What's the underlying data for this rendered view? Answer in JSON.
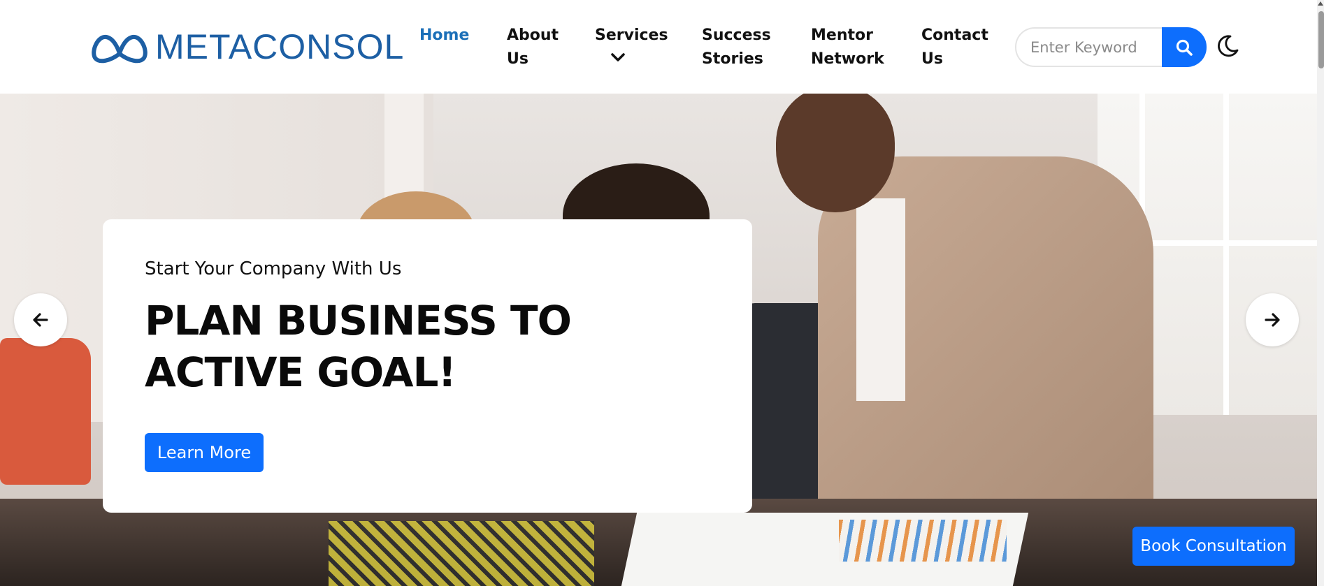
{
  "brand": {
    "name": "METACONSOL",
    "logo_icon": "infinity-mountain-logo",
    "color": "#1d5fa4"
  },
  "nav": {
    "home": "Home",
    "about_line1": "About",
    "about_line2": "Us",
    "services": "Services",
    "success_line1": "Success",
    "success_line2": "Stories",
    "mentor_line1": "Mentor",
    "mentor_line2": "Network",
    "contact_line1": "Contact",
    "contact_line2": "Us",
    "active_color": "#1b6fb8"
  },
  "search": {
    "placeholder": "Enter Keyword",
    "icon": "search-icon"
  },
  "theme_toggle": {
    "icon": "moon-icon"
  },
  "hero": {
    "subtitle": "Start Your Company With Us",
    "title": "PLAN BUSINESS TO ACTIVE GOAL!",
    "cta": "Learn More",
    "prev_icon": "arrow-left-icon",
    "next_icon": "arrow-right-icon"
  },
  "floating": {
    "book_consultation": "Book Consultation"
  },
  "colors": {
    "primary": "#0d6efd",
    "text": "#111111"
  }
}
